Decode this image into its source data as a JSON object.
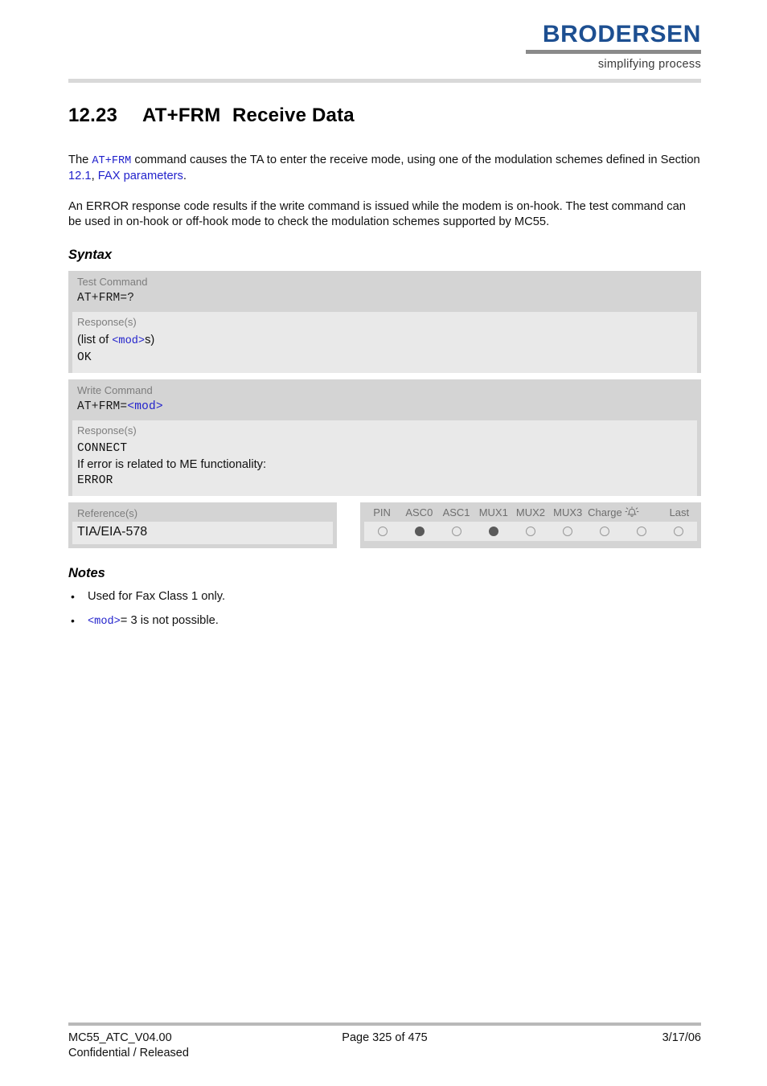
{
  "header": {
    "logo_text": "BRODERSEN",
    "logo_tagline": "simplifying process",
    "brand_color": "#1d4f91"
  },
  "title": {
    "number": "12.23",
    "command": "AT+FRM",
    "name": "Receive Data"
  },
  "intro": {
    "p1_part1": "The ",
    "p1_cmd": "AT+FRM",
    "p1_part2": " command causes the TA to enter the receive mode, using one of the modulation schemes defined in Section ",
    "p1_link1": "12.1",
    "p1_part3": ", ",
    "p1_link2": "FAX parameters",
    "p1_part4": ".",
    "p2": "An ERROR response code results if the write command is issued while the modem is on-hook. The test command can be used in on-hook or off-hook mode to check the modulation schemes supported by MC55."
  },
  "syntax": {
    "heading": "Syntax",
    "test": {
      "label": "Test Command",
      "command": "AT+FRM=?",
      "response_label": "Response(s)",
      "response_pre": "(list of ",
      "response_param": "<mod>",
      "response_post": "s)",
      "response_ok": "OK"
    },
    "write": {
      "label": "Write Command",
      "command_prefix": "AT+FRM=",
      "command_param": "<mod>",
      "response_label": "Response(s)",
      "response_connect": "CONNECT",
      "response_errtext": "If error is related to ME functionality:",
      "response_error": "ERROR"
    }
  },
  "reference": {
    "label": "Reference(s)",
    "value": "TIA/EIA-578"
  },
  "status": {
    "columns": [
      {
        "label": "PIN",
        "filled": false
      },
      {
        "label": "ASC0",
        "filled": true
      },
      {
        "label": "ASC1",
        "filled": false
      },
      {
        "label": "MUX1",
        "filled": true
      },
      {
        "label": "MUX2",
        "filled": false
      },
      {
        "label": "MUX3",
        "filled": false
      },
      {
        "label": "Charge",
        "filled": false
      },
      {
        "label": "alarm-icon",
        "filled": false
      },
      {
        "label": "Last",
        "filled": false
      }
    ],
    "filled_color": "#5a5a5a",
    "empty_border_color": "#999999"
  },
  "notes": {
    "heading": "Notes",
    "items": [
      {
        "pre": "",
        "param": "",
        "text": "Used for Fax Class 1 only."
      },
      {
        "pre": "",
        "param": "<mod>",
        "text": "= 3 is not possible."
      }
    ]
  },
  "footer": {
    "doc_id": "MC55_ATC_V04.00",
    "classification": "Confidential / Released",
    "page": "Page 325 of 475",
    "date": "3/17/06"
  }
}
